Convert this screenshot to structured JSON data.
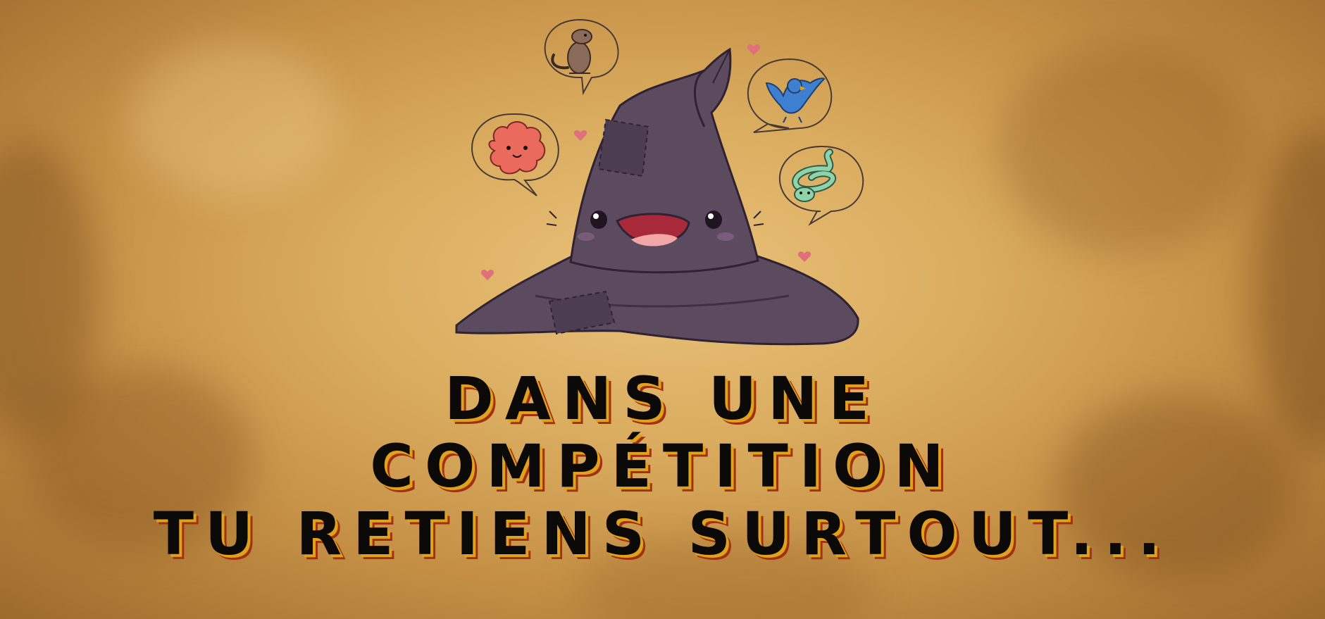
{
  "headline": {
    "lines": [
      "DANS UNE",
      "COMPÉTITION",
      "TU RETIENS SURTOUT..."
    ]
  },
  "illustration": {
    "subject": "smiling-witch-hat",
    "bubbles": [
      "ferret",
      "bird",
      "fluffy-creature",
      "snake"
    ]
  },
  "colors": {
    "parchment": "#d9ab5e",
    "hat": "#5c4a5f",
    "text": "#0c0a08",
    "text_shadow_1": "#e0a21c",
    "text_shadow_2": "#a2320f"
  }
}
